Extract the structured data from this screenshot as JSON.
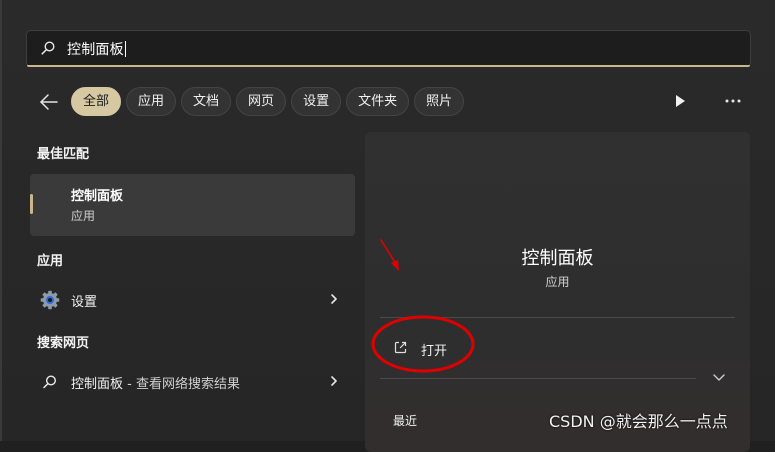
{
  "search": {
    "query": "控制面板"
  },
  "filters": [
    "全部",
    "应用",
    "文档",
    "网页",
    "设置",
    "文件夹",
    "照片"
  ],
  "left": {
    "best_match_heading": "最佳匹配",
    "best_match": {
      "title": "控制面板",
      "subtitle": "应用"
    },
    "apps_heading": "应用",
    "apps": [
      {
        "label": "设置"
      }
    ],
    "web_heading": "搜索网页",
    "web": [
      {
        "label": "控制面板",
        "suffix": " - 查看网络搜索结果"
      }
    ]
  },
  "detail": {
    "title": "控制面板",
    "subtitle": "应用",
    "action_open": "打开",
    "recent_heading": "最近"
  },
  "colors": {
    "accent": "#d6c9a2",
    "annotation": "#e00000"
  },
  "watermark": "CSDN @就会那么一点点"
}
